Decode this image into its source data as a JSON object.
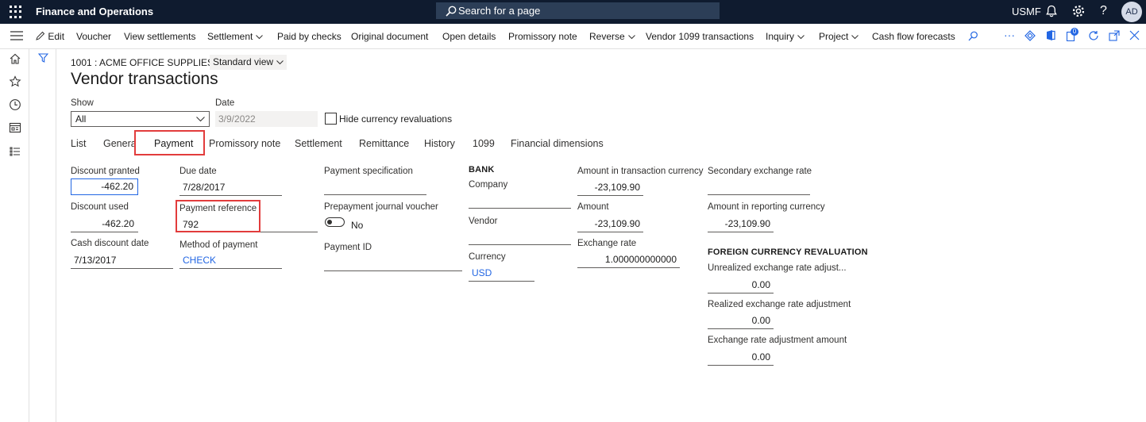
{
  "topbar": {
    "app_title": "Finance and Operations",
    "search_placeholder": "Search for a page",
    "company": "USMF",
    "avatar_initials": "AD"
  },
  "actions": {
    "edit": "Edit",
    "voucher": "Voucher",
    "view_settlements": "View settlements",
    "settlement": "Settlement",
    "paid_by_checks": "Paid by checks",
    "original_document": "Original document",
    "open_details": "Open details",
    "promissory_note": "Promissory note",
    "reverse": "Reverse",
    "vendor_1099": "Vendor 1099 transactions",
    "inquiry": "Inquiry",
    "project": "Project",
    "cash_flow": "Cash flow forecasts",
    "more": "···",
    "badge_count": "0"
  },
  "header": {
    "breadcrumb": "1001 : ACME OFFICE SUPPLIES",
    "separator": "|",
    "view": "Standard view",
    "title": "Vendor transactions"
  },
  "filters": {
    "show_label": "Show",
    "show_value": "All",
    "date_label": "Date",
    "date_value": "3/9/2022",
    "hide_label": "Hide currency revaluations"
  },
  "tabs": {
    "list": "List",
    "general": "Genera",
    "payment": "Payment",
    "promissory_note": "Promissory note",
    "settlement": "Settlement",
    "remittance": "Remittance",
    "history": "History",
    "t1099": "1099",
    "financial_dimensions": "Financial dimensions"
  },
  "payment": {
    "discount_granted_label": "Discount granted",
    "discount_granted": "-462.20",
    "discount_used_label": "Discount used",
    "discount_used": "-462.20",
    "cash_discount_date_label": "Cash discount date",
    "cash_discount_date": "7/13/2017",
    "due_date_label": "Due date",
    "due_date": "7/28/2017",
    "payment_reference_label": "Payment reference",
    "payment_reference": "792",
    "method_label": "Method of payment",
    "method": "CHECK",
    "payment_spec_label": "Payment specification",
    "payment_spec": "",
    "prepayment_label": "Prepayment journal voucher",
    "prepayment_value": "No",
    "payment_id_label": "Payment ID",
    "payment_id": "",
    "bank_heading": "BANK",
    "company_label": "Company",
    "company": "",
    "vendor_label": "Vendor",
    "vendor": "",
    "currency_label": "Currency",
    "currency": "USD",
    "amount_txn_label": "Amount in transaction currency",
    "amount_txn": "-23,109.90",
    "amount_label": "Amount",
    "amount": "-23,109.90",
    "exchange_rate_label": "Exchange rate",
    "exchange_rate": "1.000000000000",
    "secondary_rate_label": "Secondary exchange rate",
    "secondary_rate": "",
    "amount_reporting_label": "Amount in reporting currency",
    "amount_reporting": "-23,109.90",
    "fcr_heading": "FOREIGN CURRENCY REVALUATION",
    "unrealized_label": "Unrealized exchange rate adjust...",
    "unrealized": "0.00",
    "realized_label": "Realized exchange rate adjustment",
    "realized": "0.00",
    "adjustment_label": "Exchange rate adjustment amount",
    "adjustment": "0.00"
  }
}
